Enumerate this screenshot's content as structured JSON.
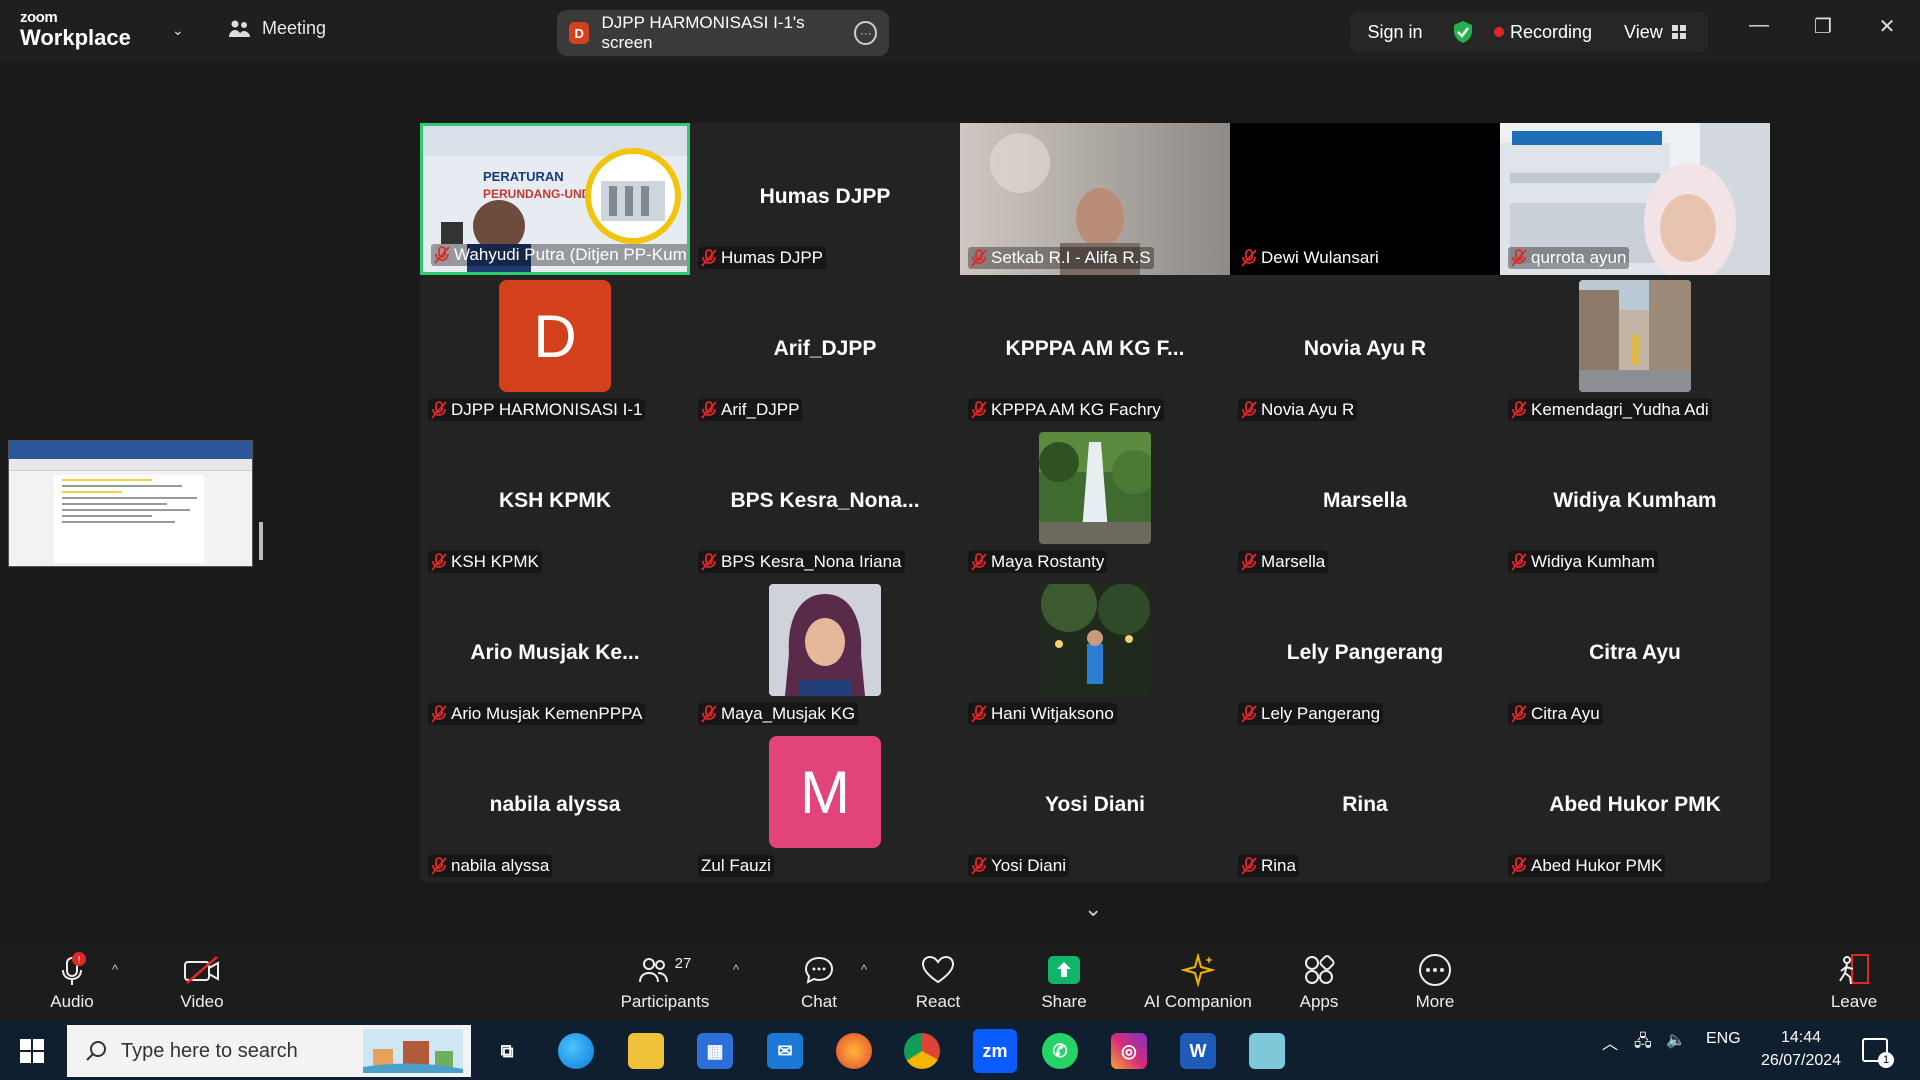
{
  "app": {
    "brand_small": "zoom",
    "brand_large": "Workplace",
    "meeting_label": "Meeting"
  },
  "share_pill": {
    "badge": "D",
    "label": "DJPP HARMONISASI I-1's screen"
  },
  "header": {
    "signin": "Sign in",
    "recording": "Recording",
    "view": "View"
  },
  "tiles": [
    {
      "name": "Wahyudi Putra (Ditjen PP-Kum...",
      "big": "",
      "kind": "video1"
    },
    {
      "name": "Humas DJPP",
      "big": "Humas DJPP",
      "kind": "text"
    },
    {
      "name": "Setkab R.I - Alifa R.S",
      "big": "",
      "kind": "video2"
    },
    {
      "name": "Dewi Wulansari",
      "big": "",
      "kind": "black"
    },
    {
      "name": "qurrota ayun",
      "big": "",
      "kind": "video3"
    },
    {
      "name": "DJPP HARMONISASI I-1",
      "big": "D",
      "kind": "avatar",
      "color": "#d2411c"
    },
    {
      "name": "Arif_DJPP",
      "big": "Arif_DJPP",
      "kind": "text"
    },
    {
      "name": "KPPPA AM KG Fachry",
      "big": "KPPPA AM KG F...",
      "kind": "text"
    },
    {
      "name": "Novia Ayu R",
      "big": "Novia Ayu R",
      "kind": "text"
    },
    {
      "name": "Kemendagri_Yudha Adi",
      "big": "",
      "kind": "photo-city"
    },
    {
      "name": "KSH KPMK",
      "big": "KSH KPMK",
      "kind": "text"
    },
    {
      "name": "BPS Kesra_Nona Iriana",
      "big": "BPS Kesra_Nona...",
      "kind": "text"
    },
    {
      "name": "Maya Rostanty",
      "big": "",
      "kind": "photo-falls"
    },
    {
      "name": "Marsella",
      "big": "Marsella",
      "kind": "text"
    },
    {
      "name": "Widiya Kumham",
      "big": "Widiya Kumham",
      "kind": "text"
    },
    {
      "name": "Ario Musjak KemenPPPA",
      "big": "Ario Musjak Ke...",
      "kind": "text"
    },
    {
      "name": "Maya_Musjak KG",
      "big": "",
      "kind": "photo-hijab"
    },
    {
      "name": "Hani Witjaksono",
      "big": "",
      "kind": "photo-night"
    },
    {
      "name": "Lely Pangerang",
      "big": "Lely Pangerang",
      "kind": "text"
    },
    {
      "name": "Citra Ayu",
      "big": "Citra Ayu",
      "kind": "text"
    },
    {
      "name": "nabila alyssa",
      "big": "nabila alyssa",
      "kind": "text"
    },
    {
      "name": "Zul Fauzi",
      "big": "M",
      "kind": "avatar",
      "color": "#e2437a",
      "nomic": true
    },
    {
      "name": "Yosi Diani",
      "big": "Yosi Diani",
      "kind": "text"
    },
    {
      "name": "Rina",
      "big": "Rina",
      "kind": "text"
    },
    {
      "name": "Abed Hukor PMK",
      "big": "Abed Hukor PMK",
      "kind": "text"
    }
  ],
  "toolbar": {
    "audio": "Audio",
    "video": "Video",
    "participants": "Participants",
    "participants_count": "27",
    "chat": "Chat",
    "react": "React",
    "share": "Share",
    "ai": "AI Companion",
    "apps": "Apps",
    "more": "More",
    "leave": "Leave"
  },
  "taskbar": {
    "search_placeholder": "Type here to search",
    "lang": "ENG",
    "time": "14:44",
    "date": "26/07/2024",
    "notif_count": "1"
  },
  "colors": {
    "accent_green": "#2ecc71",
    "record_red": "#e02828",
    "share_green": "#10b56a"
  }
}
